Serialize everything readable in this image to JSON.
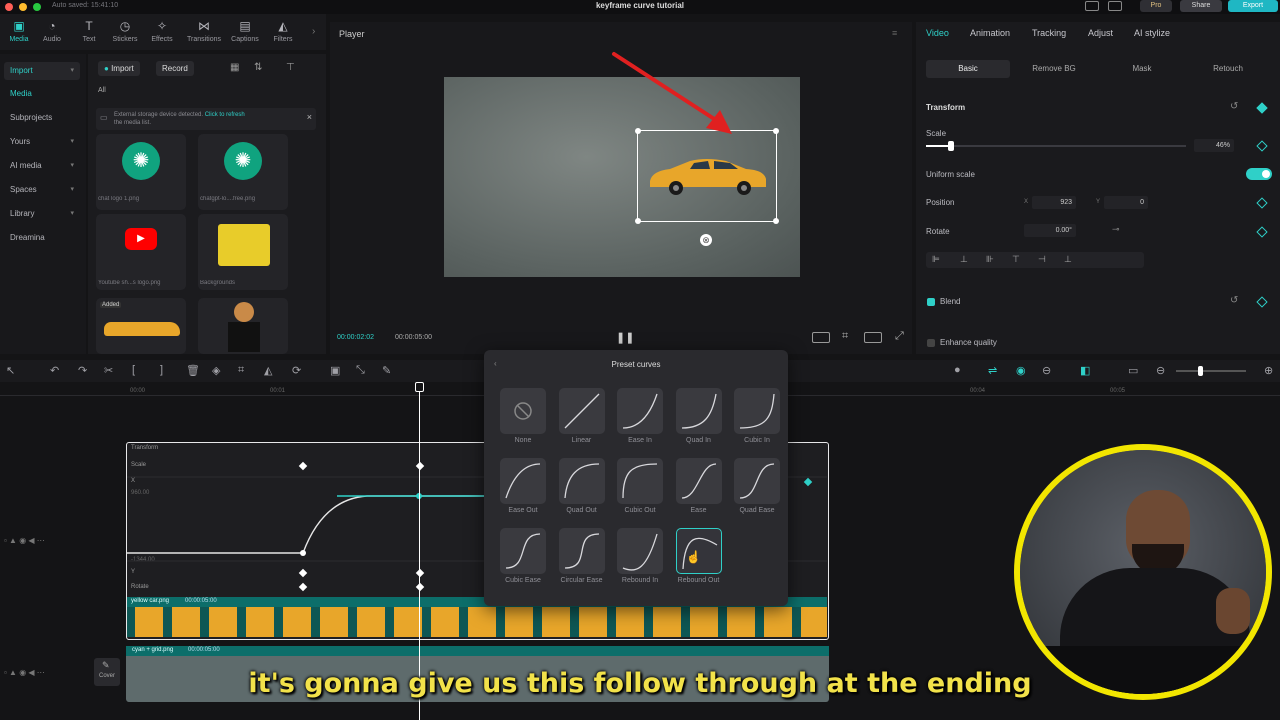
{
  "titlebar": {
    "autosave": "Auto saved: 15:41:10",
    "title": "keyframe curve tutorial",
    "pro": "Pro",
    "share": "Share",
    "export": "Export"
  },
  "toolbar": [
    "Media",
    "Audio",
    "Text",
    "Stickers",
    "Effects",
    "Transitions",
    "Captions",
    "Filters"
  ],
  "leftnav": {
    "import": "Import",
    "items": [
      "Media",
      "Subprojects",
      "Yours",
      "AI media",
      "Spaces",
      "Library",
      "Dreamina"
    ]
  },
  "media": {
    "import_btn": "Import",
    "record_btn": "Record",
    "filter_all": "All",
    "notice": "External storage device detected.",
    "notice_link": "Click to refresh",
    "notice_tail": "the media list.",
    "items": [
      {
        "name": "chat logo 1.png"
      },
      {
        "name": "chatgpt-lo....free.png"
      },
      {
        "name": "Youtube sh...s logo.png"
      },
      {
        "name": "Backgrounds"
      },
      {
        "name": "",
        "badge": "Added"
      },
      {
        "name": ""
      }
    ]
  },
  "player": {
    "title": "Player",
    "time_current": "00:00:02:02",
    "time_total": "00:00:05:00"
  },
  "props": {
    "tabs": [
      "Video",
      "Animation",
      "Tracking",
      "Adjust",
      "AI stylize"
    ],
    "subtabs": [
      "Basic",
      "Remove BG",
      "Mask",
      "Retouch"
    ],
    "transform": "Transform",
    "scale": "Scale",
    "scale_value": "46%",
    "uniform_scale": "Uniform scale",
    "position": "Position",
    "pos_x_label": "X",
    "pos_x": "923",
    "pos_y_label": "Y",
    "pos_y": "0",
    "rotate": "Rotate",
    "rotate_value": "0.00°",
    "blend": "Blend",
    "enhance": "Enhance quality"
  },
  "timeline": {
    "ticks": [
      "00:00",
      "00:01",
      "00:04",
      "00:05"
    ],
    "transform": "Transform",
    "scale": "Scale",
    "x": "X",
    "y": "Y",
    "rotate": "Rotate",
    "scale_hi": "960.00",
    "scale_lo": "-1344.00",
    "clip1": "yellow car.png",
    "clip1_dur": "00:00:05:00",
    "clip2": "cyan + grid.png",
    "clip2_dur": "00:00:05:00",
    "cover": "Cover"
  },
  "popup": {
    "title": "Preset curves",
    "curves": [
      "None",
      "Linear",
      "Ease In",
      "Quad In",
      "Cubic In",
      "Ease Out",
      "Quad Out",
      "Cubic Out",
      "Ease",
      "Quad Ease",
      "Cubic Ease",
      "Circular Ease",
      "Rebound In",
      "Rebound Out"
    ],
    "selected": "Rebound Out"
  },
  "subtitle": "it's gonna give us this follow through at the ending",
  "colors": {
    "accent": "#2fd0c8",
    "subtitle": "#f2e24a",
    "ring": "#f2e600",
    "arrow": "#e02020",
    "car": "#e8a62a"
  }
}
